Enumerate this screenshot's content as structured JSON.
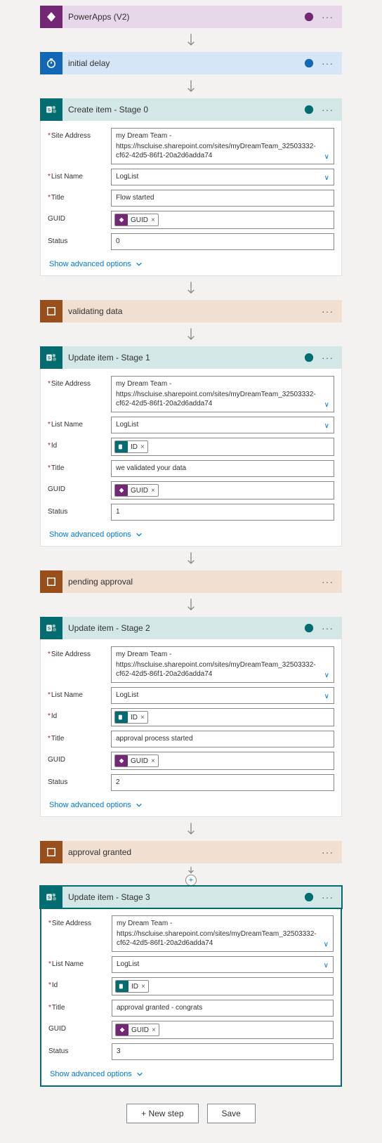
{
  "steps": {
    "powerapps": {
      "title": "PowerApps (V2)"
    },
    "delay": {
      "title": "initial delay"
    },
    "scope1": {
      "title": "validating data"
    },
    "scope2": {
      "title": "pending approval"
    },
    "scope3": {
      "title": "approval granted"
    }
  },
  "sharepoint": {
    "site_line1": "my Dream Team -",
    "site_line2": "https://hscluise.sharepoint.com/sites/myDreamTeam_32503332-cf62-42d5-86f1-20a2d6adda74"
  },
  "labels": {
    "site": "Site Address",
    "list": "List Name",
    "id": "Id",
    "title": "Title",
    "guid": "GUID",
    "status": "Status",
    "adv": "Show advanced options"
  },
  "tokens": {
    "id": "ID",
    "guid": "GUID"
  },
  "stages": [
    {
      "header": "Create item - Stage 0",
      "list": "LogList",
      "title_val": "Flow started",
      "status": "0",
      "has_id": false
    },
    {
      "header": "Update item - Stage 1",
      "list": "LogList",
      "title_val": "we validated your data",
      "status": "1",
      "has_id": true
    },
    {
      "header": "Update item - Stage 2",
      "list": "LogList",
      "title_val": "approval process started",
      "status": "2",
      "has_id": true
    },
    {
      "header": "Update item - Stage 3",
      "list": "LogList",
      "title_val": "approval granted - congrats",
      "status": "3",
      "has_id": true
    }
  ],
  "footer": {
    "newstep": "+ New step",
    "save": "Save"
  }
}
